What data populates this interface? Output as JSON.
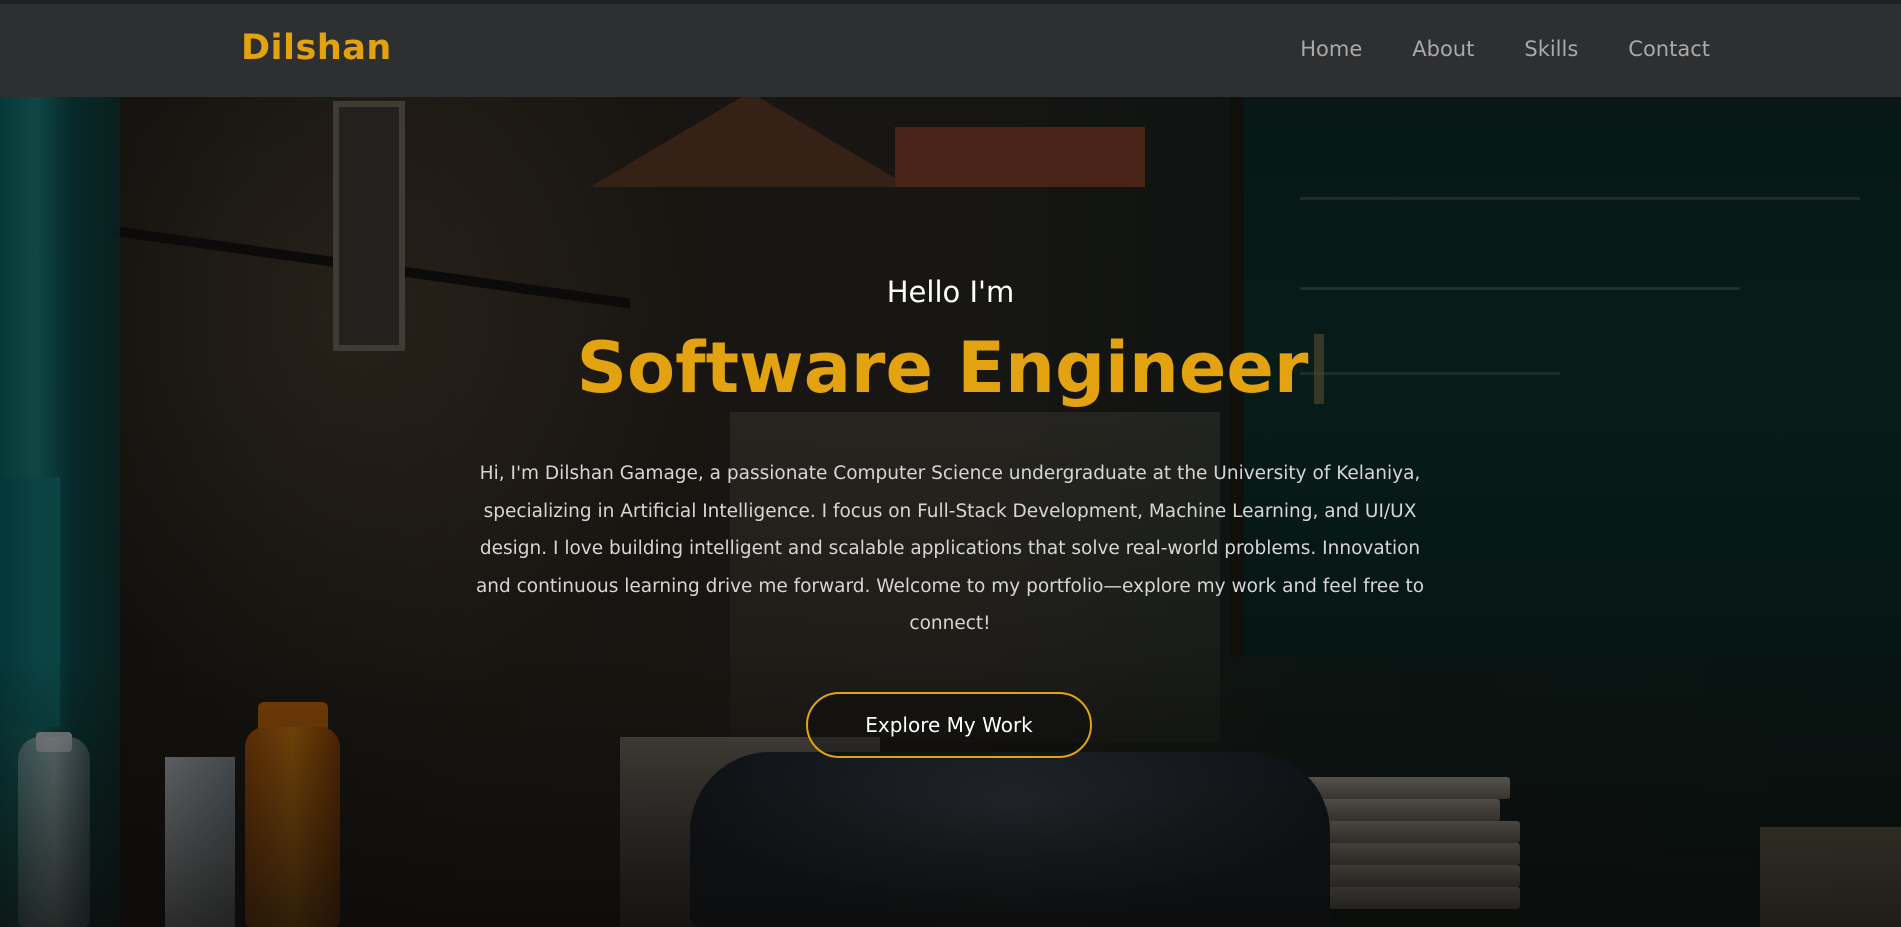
{
  "header": {
    "logo": "Dilshan",
    "nav": [
      "Home",
      "About",
      "Skills",
      "Contact"
    ]
  },
  "hero": {
    "greeting": "Hello I'm",
    "role": "Software Engineer",
    "intro": "Hi, I'm Dilshan Gamage, a passionate Computer Science undergraduate at the University of Kelaniya, specializing in Artificial Intelligence. I focus on Full-Stack Development, Machine Learning, and UI/UX design. I love building intelligent and scalable applications that solve real-world problems. Innovation and continuous learning drive me forward. Welcome to my portfolio—explore my work and feel free to connect!",
    "cta_label": "Explore My Work"
  },
  "colors": {
    "accent": "#e3a20f",
    "header_bg": "#2e2f31",
    "nav_text": "#a9a9a9"
  }
}
